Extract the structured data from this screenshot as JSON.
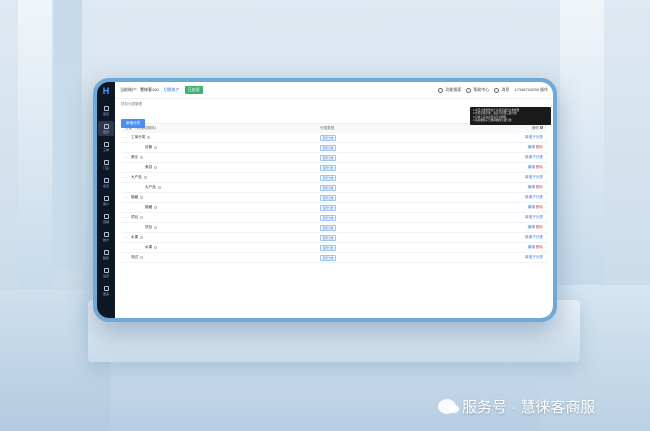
{
  "app": {
    "logo": "H",
    "sidebar": [
      {
        "label": "首页",
        "icon": "home-icon"
      },
      {
        "label": "项目",
        "icon": "project-icon",
        "active": true
      },
      {
        "label": "工单",
        "icon": "ticket-icon"
      },
      {
        "label": "门店",
        "icon": "store-icon"
      },
      {
        "label": "会员",
        "icon": "member-icon"
      },
      {
        "label": "客户",
        "icon": "customer-icon"
      },
      {
        "label": "营销",
        "icon": "marketing-icon"
      },
      {
        "label": "统计",
        "icon": "stats-icon"
      },
      {
        "label": "趋势",
        "icon": "trend-icon"
      },
      {
        "label": "设置",
        "icon": "settings-icon"
      },
      {
        "label": "更多",
        "icon": "more-icon"
      }
    ],
    "topbar": {
      "account": "当前账户：慧徕客100",
      "switch": "切换账户",
      "status": "已启用",
      "search": "功能搜索",
      "help": "帮助中心",
      "notice": "消息",
      "user": "17348704039 操作"
    },
    "breadcrumb": "项目分类管理",
    "add_button": "新增分类",
    "tooltip": [
      "1.项目分类管理用于对项目进行分类整理",
      "2.支持多级分类，最多可创建三级分类",
      "3.分类下存在项目时不可删除",
      "4.请先删除子分类再删除父级分类"
    ],
    "table": {
      "headers": {
        "name": "分类  （可拖动排序）",
        "type": "分类类型",
        "ops": "操作"
      },
      "rows": [
        {
          "name": "工单分类",
          "indent": 0,
          "caret": "−",
          "type": "服务分类",
          "ops": [
            "新增子分类"
          ]
        },
        {
          "name": "设备",
          "indent": 1,
          "caret": "",
          "type": "服务分类",
          "ops": [
            "编辑",
            "删除"
          ]
        },
        {
          "name": "美业",
          "indent": 0,
          "caret": "−",
          "type": "服务分类",
          "ops": [
            "新增子分类"
          ]
        },
        {
          "name": "美容",
          "indent": 1,
          "caret": "",
          "type": "服务分类",
          "ops": [
            "编辑",
            "删除"
          ]
        },
        {
          "name": "大产品",
          "indent": 0,
          "caret": "−",
          "type": "服务分类",
          "ops": [
            "新增子分类"
          ]
        },
        {
          "name": "大产品",
          "indent": 1,
          "caret": "",
          "type": "服务分类",
          "ops": [
            "编辑",
            "删除"
          ]
        },
        {
          "name": "隐藏",
          "indent": 0,
          "caret": "−",
          "type": "服务分类",
          "ops": [
            "新增子分类"
          ]
        },
        {
          "name": "隐藏",
          "indent": 1,
          "caret": "",
          "type": "服务分类",
          "ops": [
            "编辑",
            "删除"
          ]
        },
        {
          "name": "项目",
          "indent": 0,
          "caret": "−",
          "type": "服务分类",
          "ops": [
            "新增子分类"
          ]
        },
        {
          "name": "项目",
          "indent": 1,
          "caret": "",
          "type": "服务分类",
          "ops": [
            "编辑",
            "删除"
          ]
        },
        {
          "name": "水果",
          "indent": 0,
          "caret": "−",
          "type": "服务分类",
          "ops": [
            "新增子分类"
          ]
        },
        {
          "name": "水果",
          "indent": 1,
          "caret": "",
          "type": "服务分类",
          "ops": [
            "编辑",
            "删除"
          ]
        },
        {
          "name": "测试",
          "indent": 0,
          "caret": "",
          "type": "服务分类",
          "ops": [
            "新增子分类"
          ]
        }
      ]
    }
  },
  "watermark": "服务号 · 慧徕客商服"
}
